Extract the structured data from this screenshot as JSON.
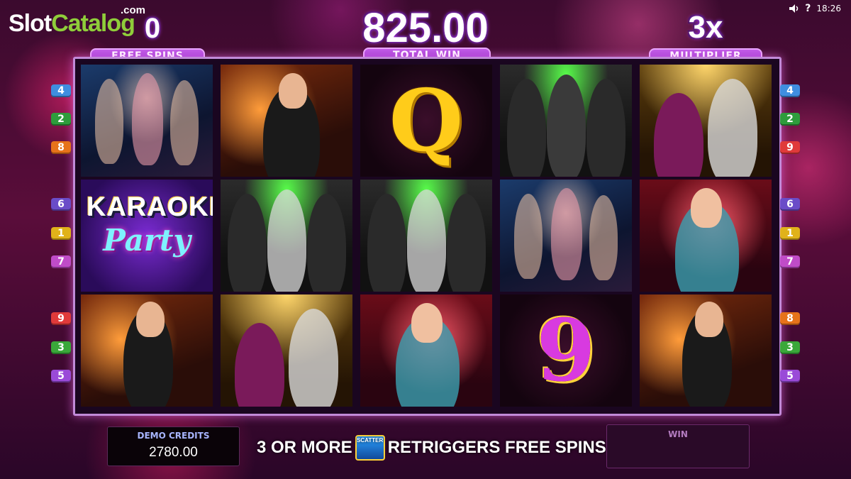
{
  "watermark": {
    "slot": "Slot",
    "catalog": "Catalog",
    "dotcom": ".com"
  },
  "status_bar": {
    "volume_icon": "speaker-icon",
    "help": "?",
    "time": "18:26"
  },
  "hud": {
    "free_spins": {
      "value": "0",
      "label": "FREE SPINS"
    },
    "total_win": {
      "value": "825.00",
      "label": "TOTAL WIN"
    },
    "multiplier": {
      "value": "3x",
      "label": "MULTIPLIER"
    }
  },
  "reels": [
    [
      {
        "symbol": "dancers"
      },
      {
        "symbol": "karaoke-party-logo",
        "line1": "KARAOKE",
        "line2": "Party"
      },
      {
        "symbol": "male-singer"
      }
    ],
    [
      {
        "symbol": "male-singer"
      },
      {
        "symbol": "boy-band"
      },
      {
        "symbol": "duet-couple"
      }
    ],
    [
      {
        "symbol": "Q",
        "text": "Q"
      },
      {
        "symbol": "boy-band"
      },
      {
        "symbol": "female-singer"
      }
    ],
    [
      {
        "symbol": "boy-band"
      },
      {
        "symbol": "dancers"
      },
      {
        "symbol": "9",
        "text": "9"
      }
    ],
    [
      {
        "symbol": "duet-couple"
      },
      {
        "symbol": "female-singer"
      },
      {
        "symbol": "male-singer"
      }
    ]
  ],
  "paylines_left": [
    {
      "n": "4",
      "color": "#3f8ee0"
    },
    {
      "n": "2",
      "color": "#2e9c3c"
    },
    {
      "n": "8",
      "color": "#e6731a"
    },
    {
      "n": "6",
      "color": "#6a4cc8"
    },
    {
      "n": "1",
      "color": "#e0b21a"
    },
    {
      "n": "7",
      "color": "#c04cc8"
    },
    {
      "n": "9",
      "color": "#e03a3a"
    },
    {
      "n": "3",
      "color": "#3aa83a"
    },
    {
      "n": "5",
      "color": "#9a4ad8"
    }
  ],
  "paylines_right": [
    {
      "n": "4",
      "color": "#3f8ee0"
    },
    {
      "n": "2",
      "color": "#2e9c3c"
    },
    {
      "n": "9",
      "color": "#e03a3a"
    },
    {
      "n": "6",
      "color": "#6a4cc8"
    },
    {
      "n": "1",
      "color": "#e0b21a"
    },
    {
      "n": "7",
      "color": "#c04cc8"
    },
    {
      "n": "8",
      "color": "#e6731a"
    },
    {
      "n": "3",
      "color": "#3aa83a"
    },
    {
      "n": "5",
      "color": "#9a4ad8"
    }
  ],
  "bottom": {
    "credits_label": "DEMO CREDITS",
    "credits_value": "2780.00",
    "message_pre": "3 OR MORE",
    "scatter_text": "SCATTER",
    "message_post": "RETRIGGERS FREE SPINS",
    "win_label": "WIN"
  }
}
